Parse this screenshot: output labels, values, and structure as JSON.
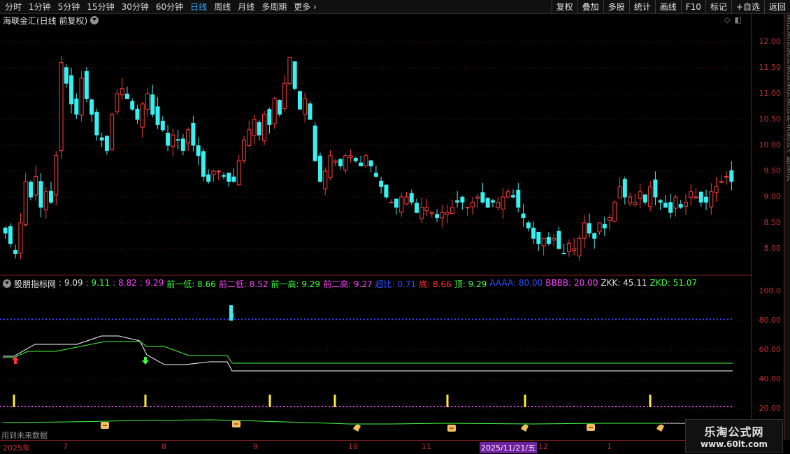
{
  "toolbar": {
    "periods": [
      "分时",
      "1分钟",
      "5分钟",
      "15分钟",
      "30分钟",
      "60分钟",
      "日线",
      "周线",
      "月线",
      "多周期",
      "更多"
    ],
    "active_index": 6,
    "more_glyph": "›",
    "right_buttons": [
      "复权",
      "叠加",
      "多股",
      "统计",
      "画线",
      "F10",
      "标记",
      "+自选",
      "返回"
    ]
  },
  "main_chart": {
    "title": "海联金汇(日线 前复权)",
    "y_ticks": [
      "12.00",
      "11.50",
      "11.00",
      "10.50",
      "10.00",
      "9.50",
      "9.00",
      "8.50",
      "8.00"
    ],
    "up_color": "#ff3d3d",
    "down_color": "#39f0f0"
  },
  "indicator": {
    "name": "股朋指标网",
    "values": [
      {
        "text": ": 9.09",
        "color": "#e0e0e0"
      },
      {
        "text": ": 9.11",
        "color": "#40ff40"
      },
      {
        "text": ": 8.82",
        "color": "#ff40ff"
      },
      {
        "text": ": 9.29",
        "color": "#ff40ff"
      },
      {
        "text": "前一低: 8.66",
        "color": "#40ff40"
      },
      {
        "text": "前二低: 8.52",
        "color": "#ff40ff"
      },
      {
        "text": "前一高: 9.29",
        "color": "#40ff40"
      },
      {
        "text": "前二高: 9.27",
        "color": "#ff40ff"
      },
      {
        "text": "超比: 0.71",
        "color": "#3050ff"
      },
      {
        "text": "底: 8.66",
        "color": "#ff3030"
      },
      {
        "text": "顶: 9.29",
        "color": "#40ff40"
      },
      {
        "text": "AAAA: 80.00",
        "color": "#3050ff"
      },
      {
        "text": "BBBB: 20.00",
        "color": "#ff40ff"
      },
      {
        "text": "ZKK: 45.11",
        "color": "#e0e0e0"
      },
      {
        "text": "ZKD: 51.07",
        "color": "#40ff40"
      }
    ],
    "y_ticks": [
      "100.0",
      "80.00",
      "60.00",
      "40.00",
      "20.00"
    ],
    "label3": "3",
    "note": "用到未来数据"
  },
  "xaxis": {
    "labels": [
      "2025年",
      "7",
      "8",
      "9",
      "10",
      "11",
      "2025/11/21/五",
      "12",
      "1"
    ],
    "highlight_index": 6
  },
  "watermark": {
    "line1": "乐淘公式网",
    "line2": "www.60lt.com"
  },
  "right_side_text": "资讯资讯资讯资讯资讯资讯相关资讯个股资讯"
}
